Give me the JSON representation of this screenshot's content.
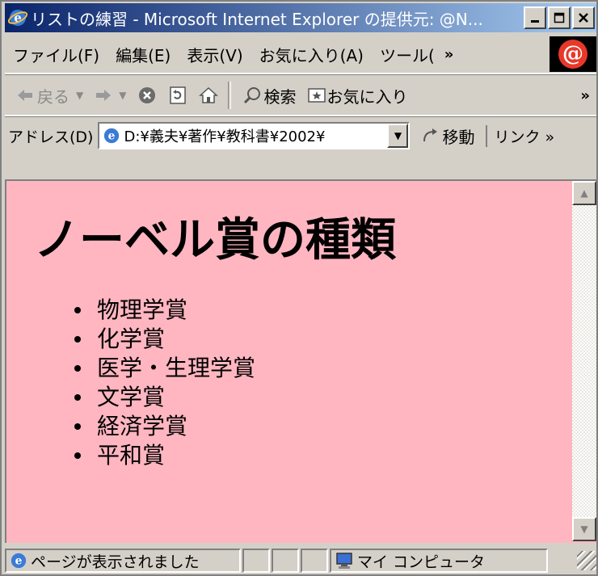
{
  "window": {
    "title": "リストの練習 - Microsoft Internet Explorer の提供元: @N..."
  },
  "menubar": {
    "items": [
      "ファイル(F)",
      "編集(E)",
      "表示(V)",
      "お気に入り(A)",
      "ツール("
    ],
    "more": "»"
  },
  "toolbar": {
    "back": "戻る",
    "search": "検索",
    "favorites": "お気に入り",
    "more": "»"
  },
  "addressbar": {
    "label": "アドレス(D)",
    "value": "D:¥義夫¥著作¥教科書¥2002¥",
    "go": "移動",
    "links": "リンク »"
  },
  "page": {
    "heading": "ノーベル賞の種類",
    "items": [
      "物理学賞",
      "化学賞",
      "医学・生理学賞",
      "文学賞",
      "経済学賞",
      "平和賞"
    ],
    "background": "#ffb6c1"
  },
  "statusbar": {
    "message": "ページが表示されました",
    "zone": "マイ コンピュータ"
  }
}
